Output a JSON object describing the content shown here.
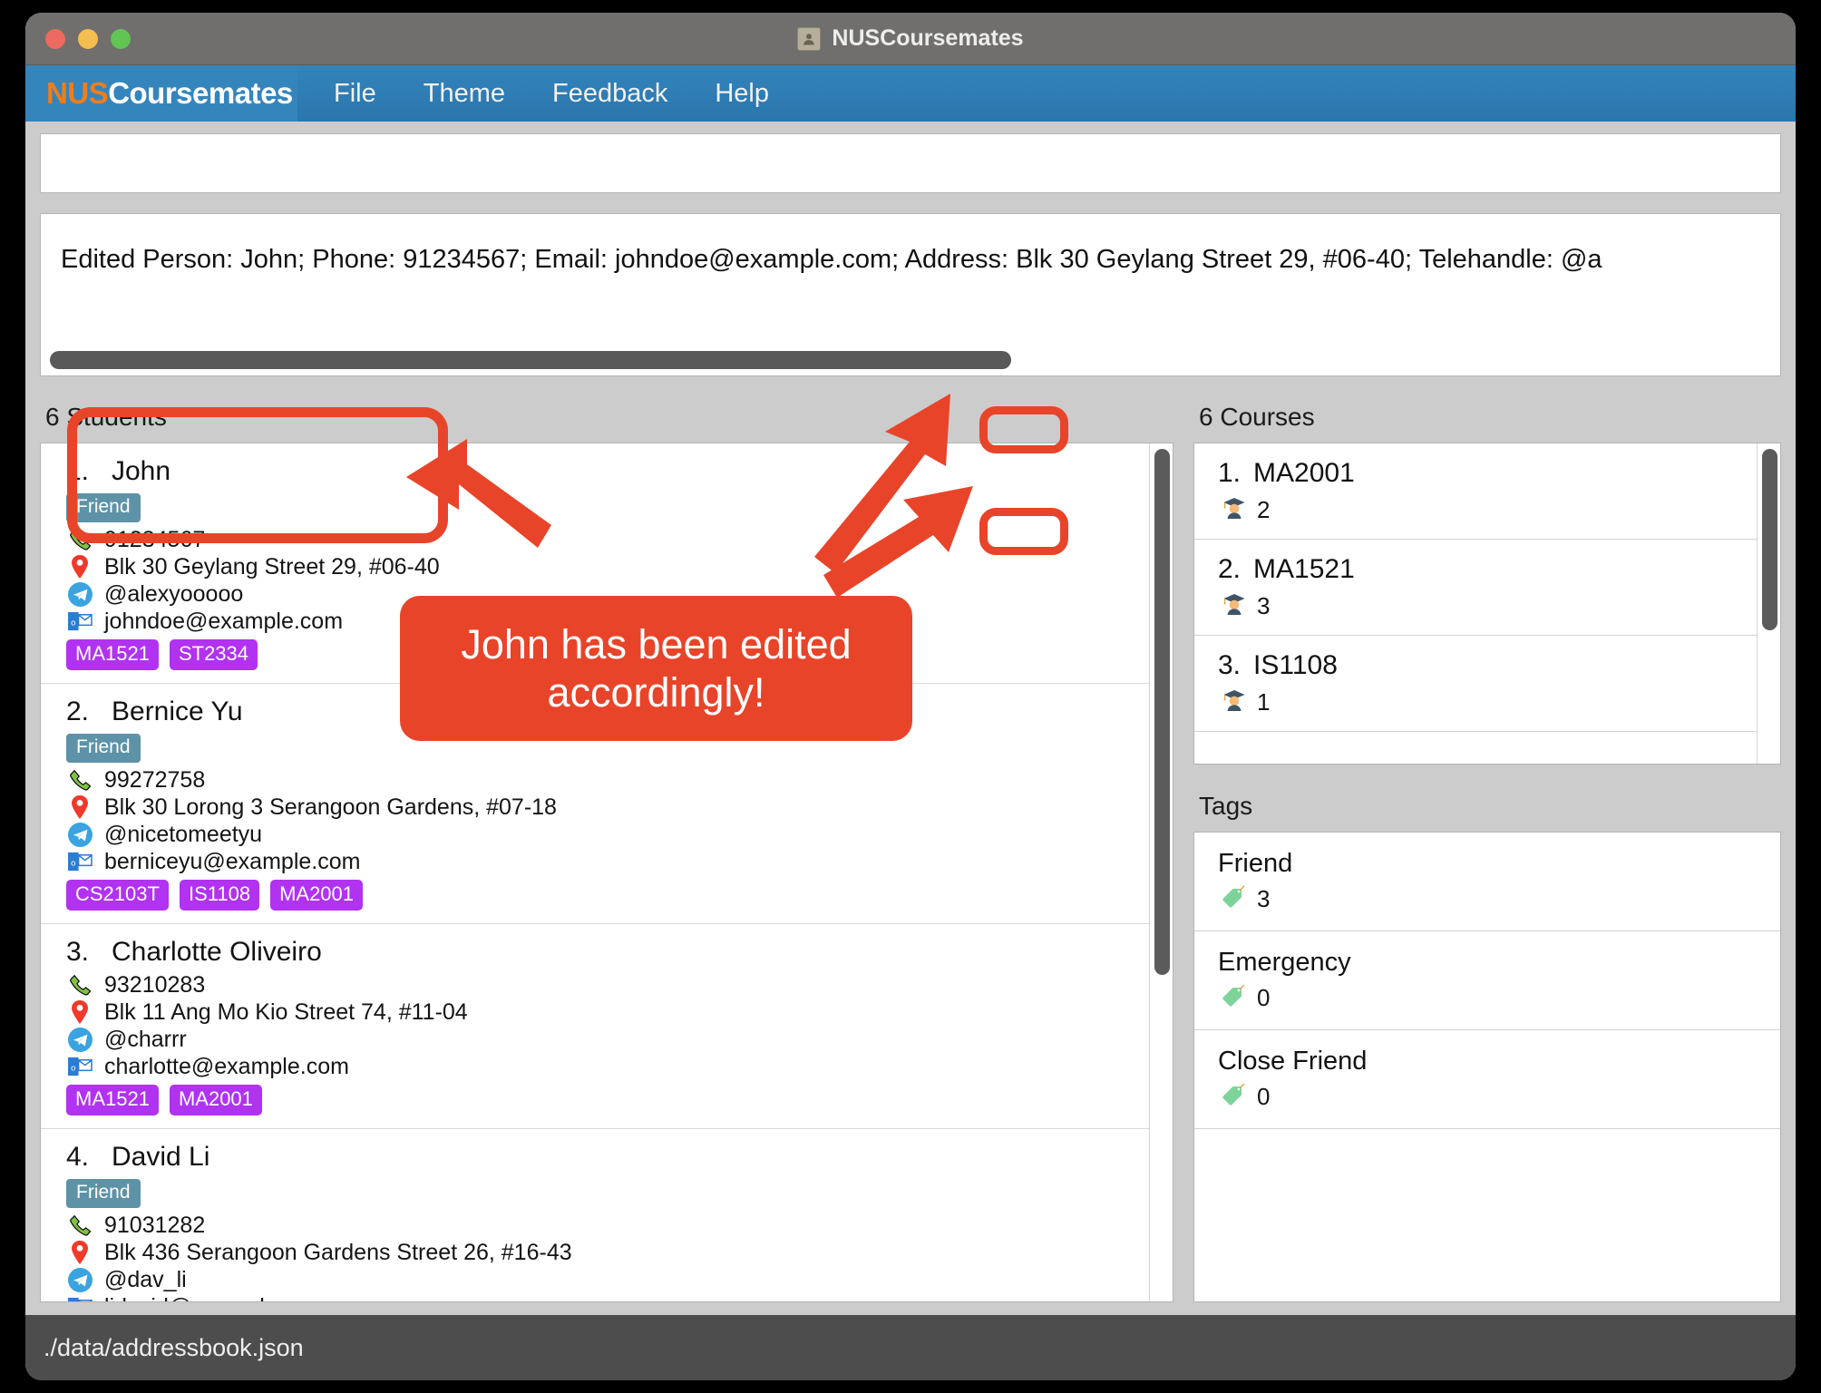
{
  "window": {
    "title": "NUSCoursemates",
    "title_icon": "address-card-icon",
    "traffic_lights": [
      "close",
      "minimize",
      "maximize"
    ]
  },
  "menubar": {
    "brand_prefix": "NUS",
    "brand_suffix": "Coursemates",
    "items": [
      {
        "label": "File"
      },
      {
        "label": "Theme"
      },
      {
        "label": "Feedback"
      },
      {
        "label": "Help"
      }
    ]
  },
  "command_box": {
    "value": "",
    "placeholder": ""
  },
  "result_display": {
    "text": "Edited Person: John; Phone: 91234567; Email: johndoe@example.com; Address: Blk 30 Geylang Street 29, #06-40; Telehandle: @a"
  },
  "students_panel": {
    "heading": "6 Students",
    "students": [
      {
        "index": "1.",
        "name": "John",
        "tags": [
          "Friend"
        ],
        "phone": "91234567",
        "address": "Blk 30 Geylang Street 29, #06-40",
        "telehandle": "@alexyooooo",
        "email": "johndoe@example.com",
        "courses": [
          "MA1521",
          "ST2334"
        ]
      },
      {
        "index": "2.",
        "name": "Bernice Yu",
        "tags": [
          "Friend"
        ],
        "phone": "99272758",
        "address": "Blk 30 Lorong 3 Serangoon Gardens, #07-18",
        "telehandle": "@nicetomeetyu",
        "email": "berniceyu@example.com",
        "courses": [
          "CS2103T",
          "IS1108",
          "MA2001"
        ]
      },
      {
        "index": "3.",
        "name": "Charlotte Oliveiro",
        "tags": [],
        "phone": "93210283",
        "address": "Blk 11 Ang Mo Kio Street 74, #11-04",
        "telehandle": "@charrr",
        "email": "charlotte@example.com",
        "courses": [
          "MA1521",
          "MA2001"
        ]
      },
      {
        "index": "4.",
        "name": "David Li",
        "tags": [
          "Friend"
        ],
        "phone": "91031282",
        "address": "Blk 436 Serangoon Gardens Street 26, #16-43",
        "telehandle": "@dav_li",
        "email": "lidavid@example.com",
        "courses": []
      }
    ]
  },
  "courses_panel": {
    "heading": "6 Courses",
    "courses": [
      {
        "index": "1.",
        "code": "MA2001",
        "student_count": "2"
      },
      {
        "index": "2.",
        "code": "MA1521",
        "student_count": "3"
      },
      {
        "index": "3.",
        "code": "IS1108",
        "student_count": "1"
      }
    ]
  },
  "tags_panel": {
    "heading": "Tags",
    "tags": [
      {
        "name": "Friend",
        "count": "3"
      },
      {
        "name": "Emergency",
        "count": "0"
      },
      {
        "name": "Close Friend",
        "count": "0"
      }
    ]
  },
  "statusbar": {
    "path": "./data/addressbook.json"
  },
  "annotation": {
    "callout_text": "John has been edited accordingly!",
    "highlight_color": "#e8442a",
    "boxes": [
      "john-details-box",
      "ma2001-count-box",
      "ma1521-count-box"
    ]
  },
  "icons": {
    "phone": "☎",
    "location": "📍",
    "telegram": "✈",
    "email": "✉",
    "student": "🎓",
    "tag": "🏷"
  },
  "colors": {
    "menubar_blue": "#2e7cb3",
    "brand_orange": "#f07d1a",
    "tag_badge_teal": "#5e92a6",
    "course_chip_purple": "#b132f0",
    "annotation_red": "#e8442a"
  }
}
